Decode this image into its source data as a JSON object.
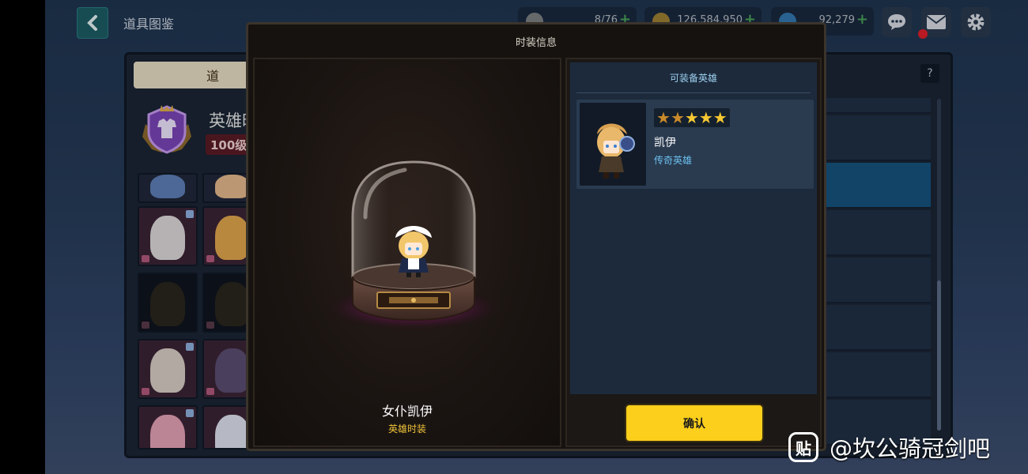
{
  "header": {
    "title": "道具图鉴",
    "resources": [
      {
        "icon": "coffee-cup-icon",
        "value": "8/76"
      },
      {
        "icon": "gold-coin-icon",
        "value": "126,584,950"
      },
      {
        "icon": "blue-gem-icon",
        "value": "92,279"
      }
    ]
  },
  "background_panel": {
    "tab_label": "道",
    "hero_name": "英雄时",
    "level_badge": "100级"
  },
  "modal": {
    "title": "时装信息",
    "costume_name": "女仆凯伊",
    "costume_type": "英雄时装",
    "equip_section_title": "可装备英雄",
    "hero": {
      "name": "凯伊",
      "rarity": "传奇英雄",
      "stars": 5
    },
    "confirm_label": "确认"
  },
  "watermark": {
    "logo_char": "贴",
    "text": "@坎公骑冠剑吧"
  },
  "colors": {
    "confirm_button": "#fbcf1b",
    "rarity_text": "#6cc0ef",
    "costume_type_text": "#f0c33a"
  }
}
